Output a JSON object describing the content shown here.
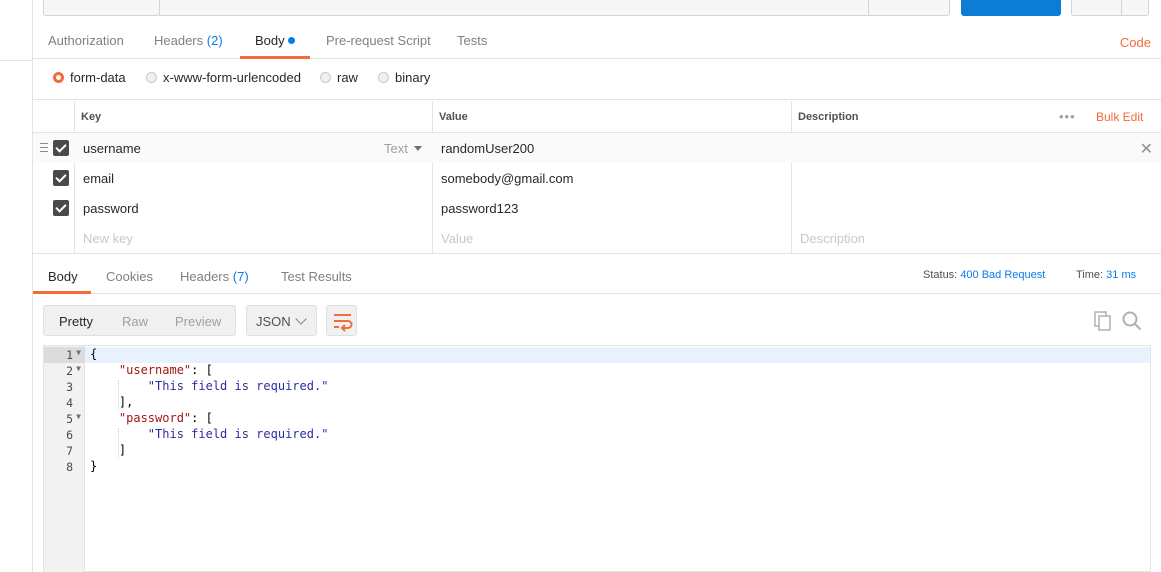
{
  "request_tabs": {
    "authorization": "Authorization",
    "headers": "Headers",
    "headers_count": "(2)",
    "body": "Body",
    "pre_request": "Pre-request Script",
    "tests": "Tests",
    "code": "Code"
  },
  "body_types": {
    "form_data": "form-data",
    "urlencoded": "x-www-form-urlencoded",
    "raw": "raw",
    "binary": "binary",
    "selected": "form-data"
  },
  "params_table": {
    "headers": {
      "key": "Key",
      "value": "Value",
      "description": "Description",
      "more": "•••",
      "bulk_edit": "Bulk Edit"
    },
    "rows": [
      {
        "key": "username",
        "value": "randomUser200",
        "type": "Text",
        "checked": true
      },
      {
        "key": "email",
        "value": "somebody@gmail.com",
        "checked": true
      },
      {
        "key": "password",
        "value": "password123",
        "checked": true
      }
    ],
    "placeholders": {
      "key": "New key",
      "value": "Value",
      "description": "Description"
    }
  },
  "response_tabs": {
    "body": "Body",
    "cookies": "Cookies",
    "headers": "Headers",
    "headers_count": "(7)",
    "test_results": "Test Results"
  },
  "response_status": {
    "status_label": "Status:",
    "status_value": "400 Bad Request",
    "time_label": "Time:",
    "time_value": "31 ms"
  },
  "response_view": {
    "pretty": "Pretty",
    "raw": "Raw",
    "preview": "Preview",
    "format": "JSON"
  },
  "code": {
    "line_numbers": [
      "1",
      "2",
      "3",
      "4",
      "5",
      "6",
      "7",
      "8"
    ],
    "lines": {
      "l1": "{",
      "l2_key": "\"username\"",
      "l2_rest": ": [",
      "l3": "\"This field is required.\"",
      "l4": "],",
      "l5_key": "\"password\"",
      "l5_rest": ": [",
      "l6": "\"This field is required.\"",
      "l7": "]",
      "l8": "}"
    }
  },
  "colors": {
    "accent": "#f26b3a",
    "link": "#097bed",
    "send_button": "#0c7cd5"
  },
  "icons": [
    "drag-handle-icon",
    "checkbox-checked-icon",
    "caret-down-icon",
    "close-icon",
    "more-icon",
    "chevron-down-icon",
    "wrap-lines-icon",
    "copy-icon",
    "search-icon",
    "fold-arrow-icon"
  ]
}
